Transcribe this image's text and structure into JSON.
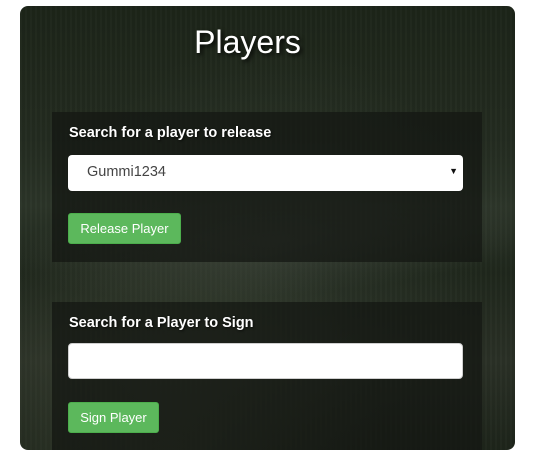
{
  "page": {
    "title": "Players"
  },
  "release_section": {
    "label": "Search for a player to release",
    "select": {
      "selected_value": "Gummi1234",
      "arrow": "▼"
    },
    "button_label": "Release Player",
    "button_color": "#5cb85c"
  },
  "sign_section": {
    "label": "Search for a Player to Sign",
    "input": {
      "value": "",
      "placeholder": ""
    },
    "button_label": "Sign Player",
    "button_color": "#5cb85c"
  }
}
